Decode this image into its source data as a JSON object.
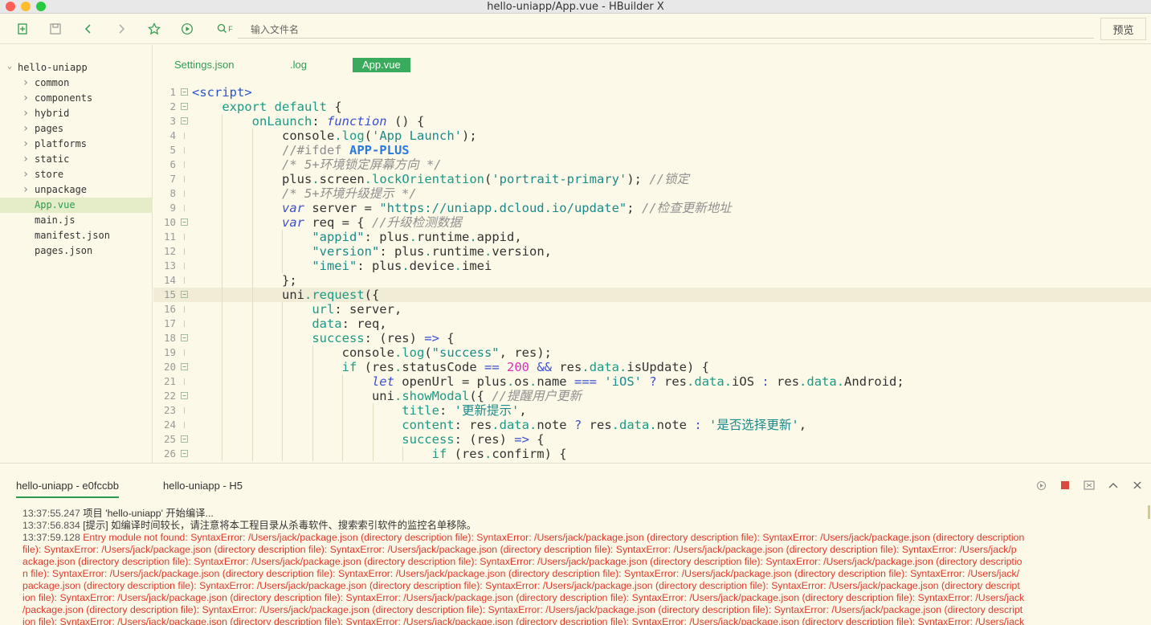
{
  "window": {
    "title": "hello-uniapp/App.vue - HBuilder X"
  },
  "toolbar": {
    "file_placeholder": "输入文件名",
    "filter_label": "F",
    "preview_label": "预览"
  },
  "colors": {
    "accent": "#3aab5c",
    "error": "#e0392b",
    "background": "#fdf9e8"
  },
  "sidebar": {
    "root": "hello-uniapp",
    "items": [
      {
        "label": "common",
        "folder": true
      },
      {
        "label": "components",
        "folder": true
      },
      {
        "label": "hybrid",
        "folder": true
      },
      {
        "label": "pages",
        "folder": true
      },
      {
        "label": "platforms",
        "folder": true
      },
      {
        "label": "static",
        "folder": true
      },
      {
        "label": "store",
        "folder": true
      },
      {
        "label": "unpackage",
        "folder": true
      },
      {
        "label": "App.vue",
        "folder": false,
        "selected": true
      },
      {
        "label": "main.js",
        "folder": false
      },
      {
        "label": "manifest.json",
        "folder": false
      },
      {
        "label": "pages.json",
        "folder": false
      }
    ]
  },
  "tabs": [
    {
      "label": "Settings.json",
      "active": false
    },
    {
      "label": ".log",
      "active": false
    },
    {
      "label": "App.vue",
      "active": true
    }
  ],
  "code": {
    "current_line": 15,
    "lines": [
      {
        "n": "1",
        "fold": "⊟",
        "text": "<script>"
      },
      {
        "n": "2",
        "fold": "⊟",
        "text": "    export default {"
      },
      {
        "n": "3",
        "fold": "⊟",
        "text": "        onLaunch: function () {"
      },
      {
        "n": "4",
        "fold": "",
        "text": "            console.log('App Launch');"
      },
      {
        "n": "5",
        "fold": "",
        "text": "            //#ifdef APP-PLUS"
      },
      {
        "n": "6",
        "fold": "",
        "text": "            /* 5+环境锁定屏幕方向 */"
      },
      {
        "n": "7",
        "fold": "",
        "text": "            plus.screen.lockOrientation('portrait-primary'); //锁定"
      },
      {
        "n": "8",
        "fold": "",
        "text": "            /* 5+环境升级提示 */"
      },
      {
        "n": "9",
        "fold": "",
        "text": "            var server = \"https://uniapp.dcloud.io/update\"; //检查更新地址"
      },
      {
        "n": "10",
        "fold": "⊟",
        "text": "            var req = { //升级检测数据"
      },
      {
        "n": "11",
        "fold": "",
        "text": "                \"appid\": plus.runtime.appid,"
      },
      {
        "n": "12",
        "fold": "",
        "text": "                \"version\": plus.runtime.version,"
      },
      {
        "n": "13",
        "fold": "",
        "text": "                \"imei\": plus.device.imei"
      },
      {
        "n": "14",
        "fold": "",
        "text": "            };"
      },
      {
        "n": "15",
        "fold": "⊟",
        "text": "            uni.request({"
      },
      {
        "n": "16",
        "fold": "",
        "text": "                url: server,"
      },
      {
        "n": "17",
        "fold": "",
        "text": "                data: req,"
      },
      {
        "n": "18",
        "fold": "⊟",
        "text": "                success: (res) => {"
      },
      {
        "n": "19",
        "fold": "",
        "text": "                    console.log(\"success\", res);"
      },
      {
        "n": "20",
        "fold": "⊟",
        "text": "                    if (res.statusCode == 200 && res.data.isUpdate) {"
      },
      {
        "n": "21",
        "fold": "",
        "text": "                        let openUrl = plus.os.name === 'iOS' ? res.data.iOS : res.data.Android;"
      },
      {
        "n": "22",
        "fold": "⊟",
        "text": "                        uni.showModal({ //提醒用户更新"
      },
      {
        "n": "23",
        "fold": "",
        "text": "                            title: '更新提示',"
      },
      {
        "n": "24",
        "fold": "",
        "text": "                            content: res.data.note ? res.data.note : '是否选择更新',"
      },
      {
        "n": "25",
        "fold": "⊟",
        "text": "                            success: (res) => {"
      },
      {
        "n": "26",
        "fold": "⊟",
        "text": "                                if (res.confirm) {"
      }
    ]
  },
  "console": {
    "tabs": [
      {
        "label": "hello-uniapp - e0fccbb",
        "active": true
      },
      {
        "label": "hello-uniapp - H5",
        "active": false
      }
    ],
    "logs": [
      {
        "time": "13:37:55.247",
        "text": "项目 'hello-uniapp' 开始编译..."
      },
      {
        "time": "13:37:56.834",
        "text": "[提示] 如编译时间较长，请注意将本工程目录从杀毒软件、搜索索引软件的监控名单移除。"
      },
      {
        "time": "13:37:59.128",
        "text": "Entry module not found: SyntaxError: /Users/jack/package.json (directory description file): SyntaxError: /Users/jack/package.json (directory description file): SyntaxError: /Users/jack/package.json (directory description"
      }
    ],
    "error_lines": [
      " file): SyntaxError: /Users/jack/package.json (directory description file): SyntaxError: /Users/jack/package.json (directory description file): SyntaxError: /Users/jack/package.json (directory description file): SyntaxError: /Users/jack/p",
      "ackage.json (directory description file): SyntaxError: /Users/jack/package.json (directory description file): SyntaxError: /Users/jack/package.json (directory description file): SyntaxError: /Users/jack/package.json (directory descriptio",
      "n file): SyntaxError: /Users/jack/package.json (directory description file): SyntaxError: /Users/jack/package.json (directory description file): SyntaxError: /Users/jack/package.json (directory description file): SyntaxError: /Users/jack/",
      "package.json (directory description file): SyntaxError: /Users/jack/package.json (directory description file): SyntaxError: /Users/jack/package.json (directory description file): SyntaxError: /Users/jack/package.json (directory descript",
      "ion file): SyntaxError: /Users/jack/package.json (directory description file): SyntaxError: /Users/jack/package.json (directory description file): SyntaxError: /Users/jack/package.json (directory description file): SyntaxError: /Users/jack",
      "/package.json (directory description file): SyntaxError: /Users/jack/package.json (directory description file): SyntaxError: /Users/jack/package.json (directory description file): SyntaxError: /Users/jack/package.json (directory descript",
      "ion file): SyntaxError: /Users/jack/package.json (directory description file): SyntaxError: /Users/jack/package.json (directory description file): SyntaxError: /Users/jack/package.json (directory description file): SyntaxError: /Users/jack"
    ]
  }
}
